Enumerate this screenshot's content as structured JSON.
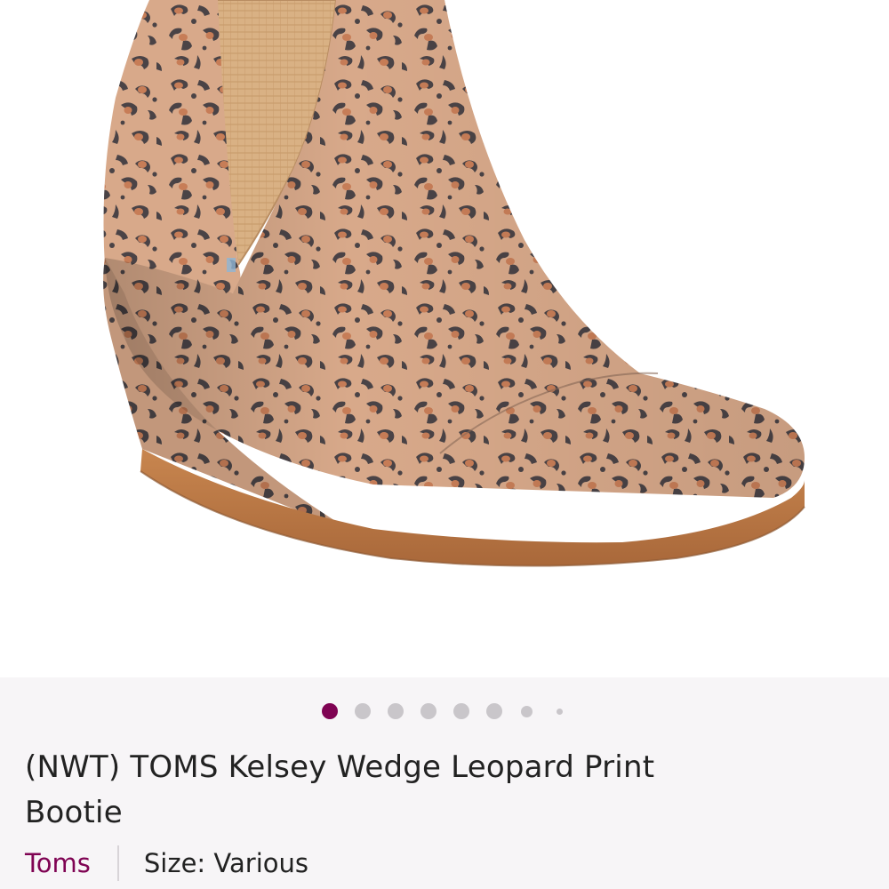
{
  "listing": {
    "title": "(NWT) TOMS Kelsey Wedge Leopard Print Bootie",
    "brand": "Toms",
    "size_label": "Size: Various"
  },
  "carousel": {
    "total_images": 8,
    "active_index": 0
  },
  "colors": {
    "accent": "#7f0353",
    "dot_inactive": "#c9c6ca",
    "panel_bg": "#f7f5f7",
    "text": "#222222"
  },
  "photo": {
    "subject": "leopard-print-wedge-bootie"
  }
}
